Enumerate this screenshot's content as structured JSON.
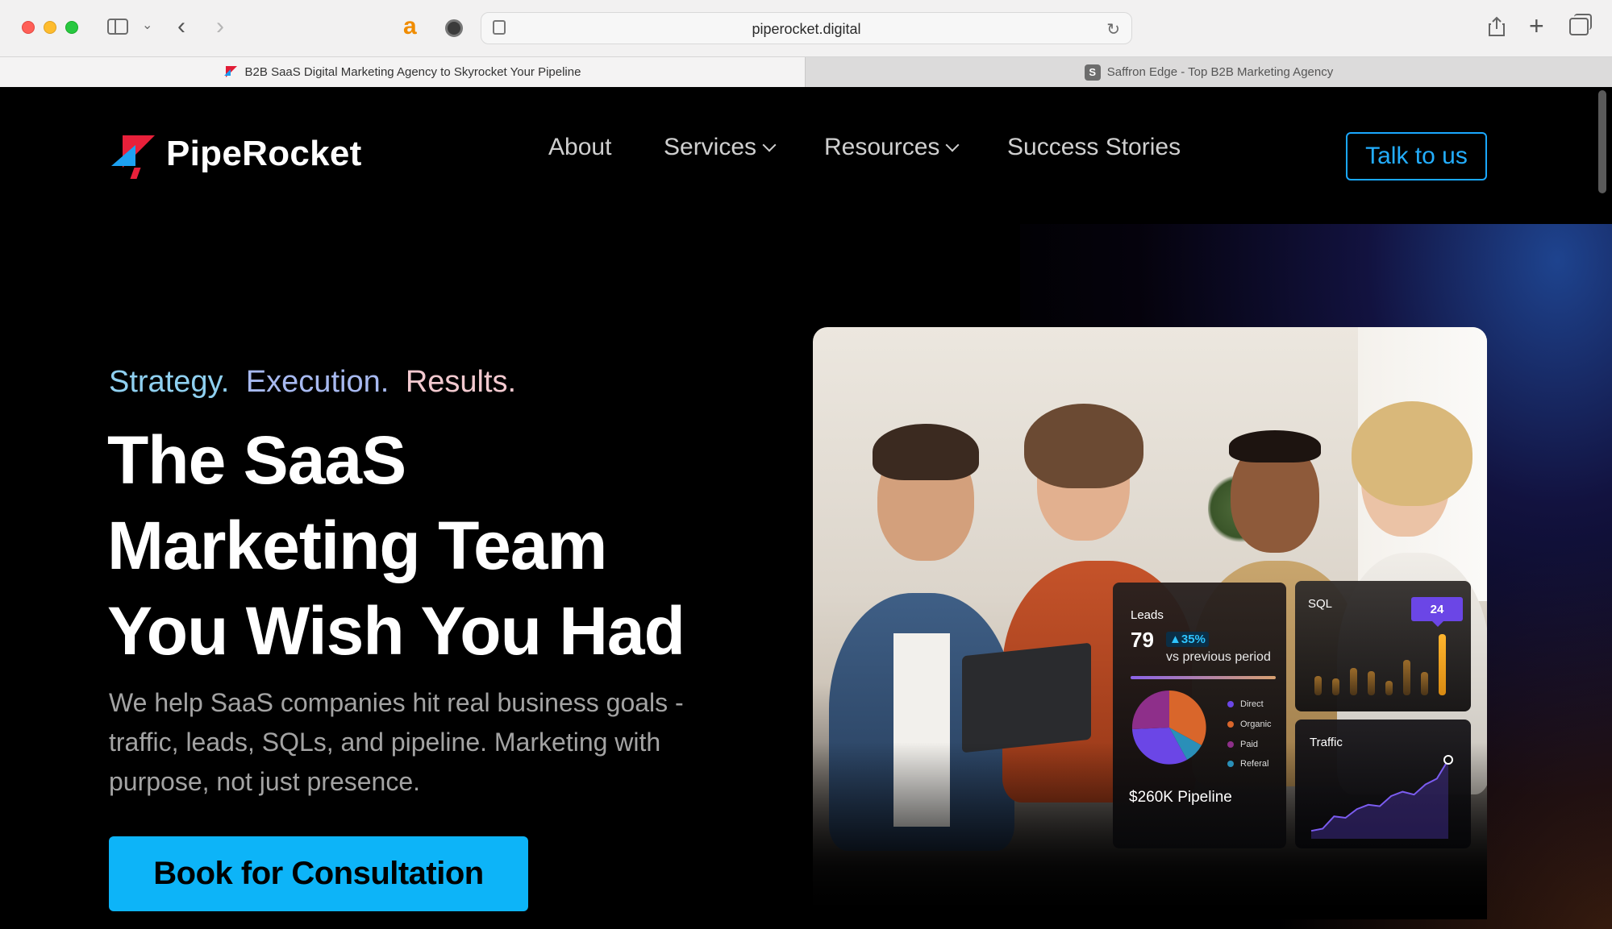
{
  "browser": {
    "url": "piperocket.digital",
    "tabs": [
      {
        "title": "B2B SaaS Digital Marketing Agency to Skyrocket Your Pipeline",
        "active": true
      },
      {
        "title": "Saffron Edge - Top B2B Marketing Agency",
        "active": false,
        "favicon_letter": "S"
      }
    ],
    "extensions": [
      "amazon-assistant-icon",
      "screen-recorder-icon"
    ]
  },
  "site": {
    "brand": "PipeRocket",
    "nav": {
      "about": "About",
      "services": "Services",
      "resources": "Resources",
      "success_stories": "Success Stories"
    },
    "talk_button": "Talk to us"
  },
  "hero": {
    "tagline": {
      "strategy": "Strategy.",
      "execution": "Execution.",
      "results": "Results."
    },
    "headline": {
      "line1": "The SaaS",
      "line2": "Marketing Team",
      "line3": "You Wish You Had"
    },
    "subtext": "We help SaaS companies hit real business goals - traffic, leads, SQLs, and pipeline. Marketing with purpose, not just presence.",
    "cta": "Book for Consultation"
  },
  "dashboard": {
    "leads": {
      "label": "Leads",
      "value": "79",
      "delta": "▲35%",
      "delta_caption": "vs previous period"
    },
    "legend": {
      "direct": "Direct",
      "organic": "Organic",
      "paid": "Paid",
      "referal": "Referal"
    },
    "pipeline": "$260K Pipeline",
    "sql": {
      "label": "SQL",
      "badge": "24",
      "bars": [
        0.32,
        0.28,
        0.45,
        0.4,
        0.24,
        0.58,
        0.38,
        1.0
      ]
    },
    "traffic": {
      "label": "Traffic",
      "trend": [
        0.02,
        0.05,
        0.22,
        0.2,
        0.32,
        0.38,
        0.36,
        0.5,
        0.56,
        0.52,
        0.66,
        0.74,
        1.0
      ]
    },
    "colors": {
      "direct": "#6b46e6",
      "organic": "#d9662b",
      "paid": "#8e2f8a",
      "referal": "#2a8fb8"
    }
  },
  "colors": {
    "accent_blue": "#0db4f8",
    "brand_red": "#e8203a",
    "tagline_strategy": "#8fd0f0",
    "tagline_execution": "#a7b9f0",
    "tagline_results": "#f2c9cf"
  }
}
